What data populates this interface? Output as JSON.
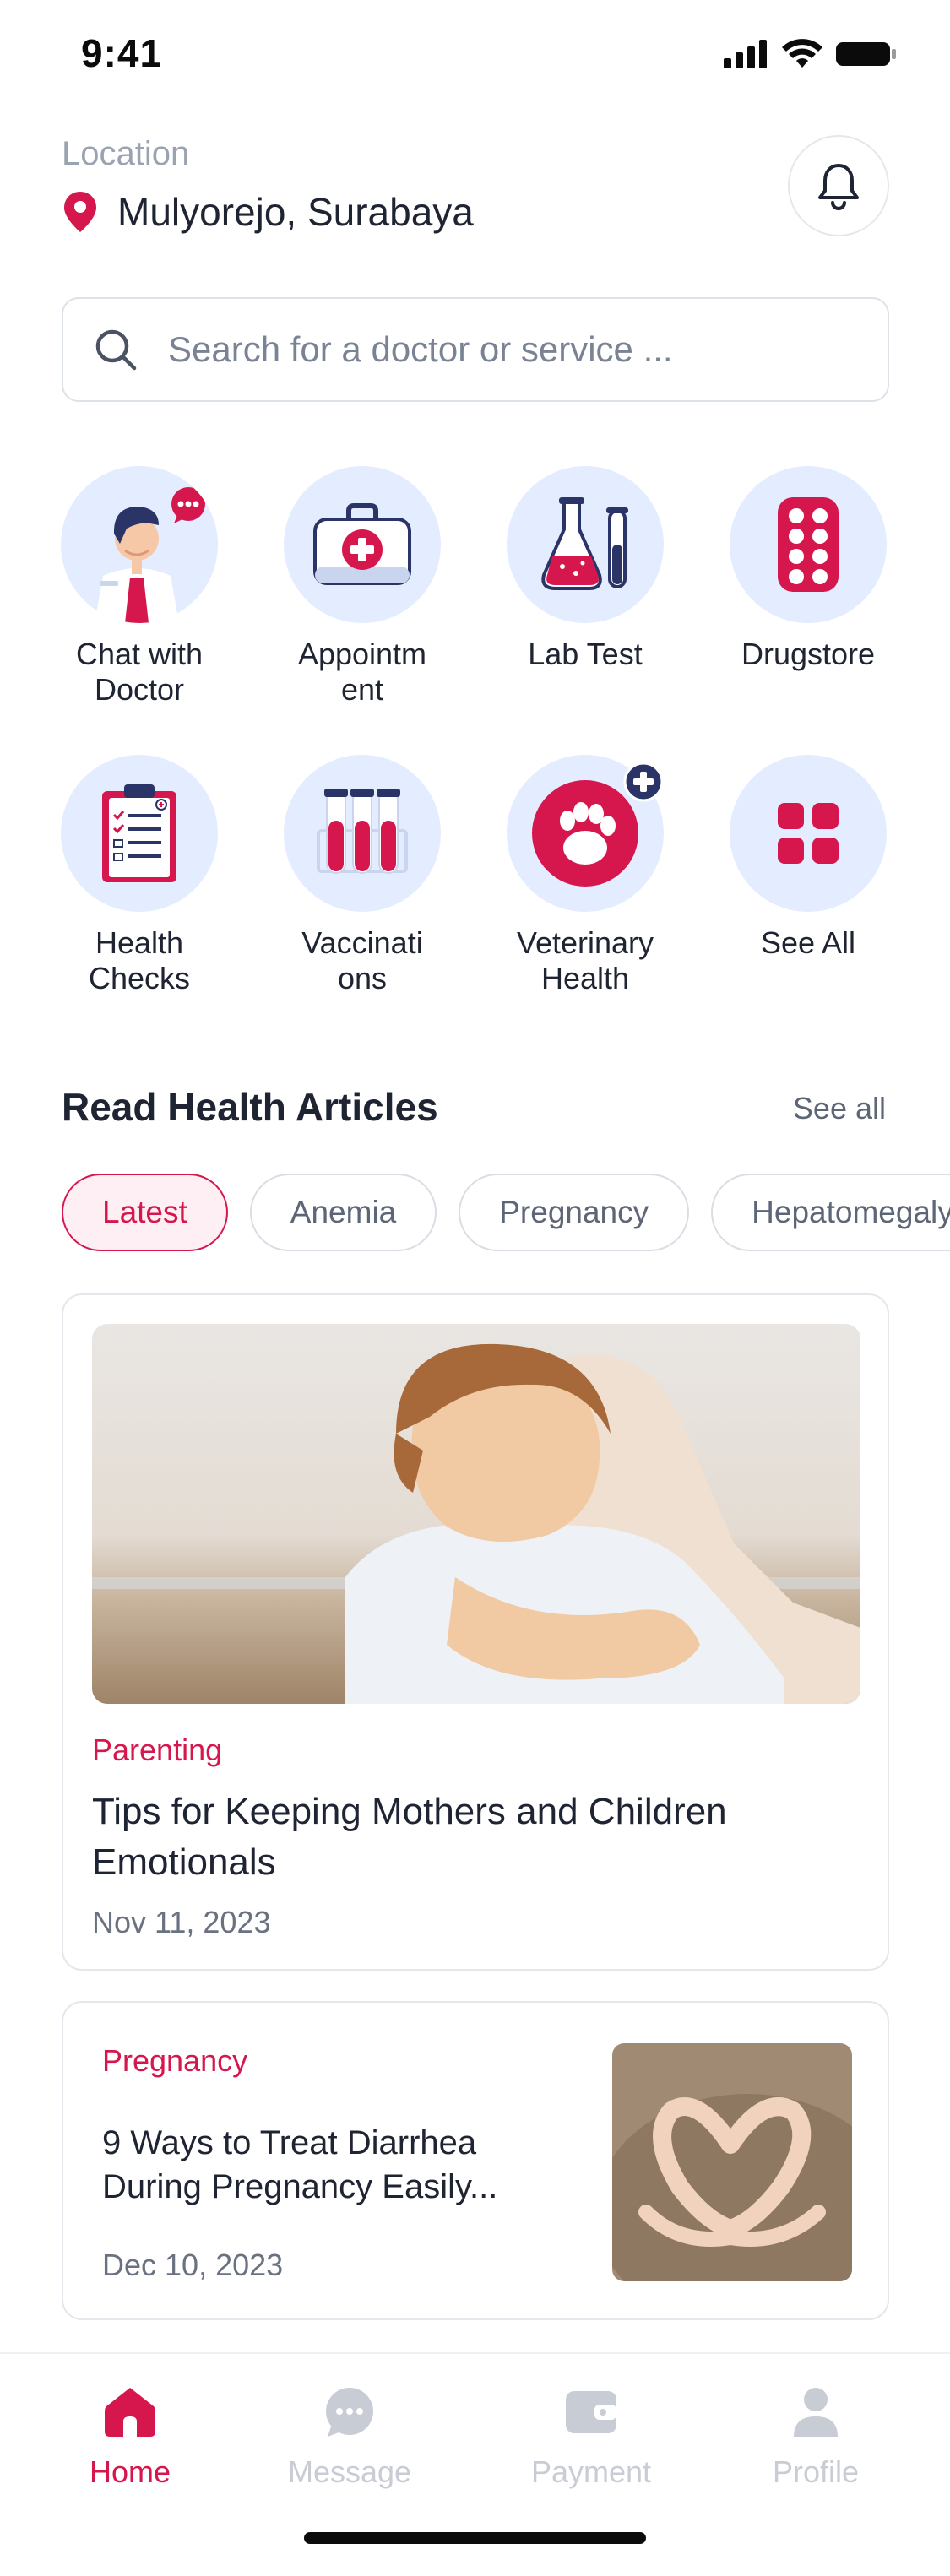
{
  "status_bar": {
    "time": "9:41"
  },
  "header": {
    "location_label": "Location",
    "location_value": "Mulyorejo, Surabaya"
  },
  "search": {
    "placeholder": "Search for a doctor or service ..."
  },
  "services": [
    {
      "label": "Chat with\nDoctor",
      "icon": "doctor-chat-icon"
    },
    {
      "label": "Appointm\nent",
      "icon": "first-aid-kit-icon"
    },
    {
      "label": "Lab Test",
      "icon": "lab-flask-icon"
    },
    {
      "label": "Drugstore",
      "icon": "pill-pack-icon"
    },
    {
      "label": "Health\nChecks",
      "icon": "clipboard-checklist-icon"
    },
    {
      "label": "Vaccinati\nons",
      "icon": "test-tubes-icon"
    },
    {
      "label": "Veterinary\nHealth",
      "icon": "paw-icon"
    },
    {
      "label": "See All",
      "icon": "grid-icon"
    }
  ],
  "articles": {
    "section_title": "Read Health Articles",
    "see_all": "See all",
    "filters": [
      "Latest",
      "Anemia",
      "Pregnancy",
      "Hepatomegaly"
    ],
    "active_filter": "Latest",
    "featured": {
      "category": "Parenting",
      "title": "Tips for Keeping Mothers and Children Emotionals",
      "date": "Nov 11, 2023"
    },
    "list": [
      {
        "category": "Pregnancy",
        "title": "9 Ways to Treat Diarrhea During Pregnancy Easily...",
        "date": "Dec 10, 2023"
      }
    ]
  },
  "nav": {
    "items": [
      {
        "label": "Home",
        "icon": "home-icon",
        "active": true
      },
      {
        "label": "Message",
        "icon": "message-icon",
        "active": false
      },
      {
        "label": "Payment",
        "icon": "wallet-icon",
        "active": false
      },
      {
        "label": "Profile",
        "icon": "profile-icon",
        "active": false
      }
    ]
  },
  "colors": {
    "accent": "#d6174d",
    "icon_bg": "#e3edff",
    "navy": "#2b3467"
  }
}
